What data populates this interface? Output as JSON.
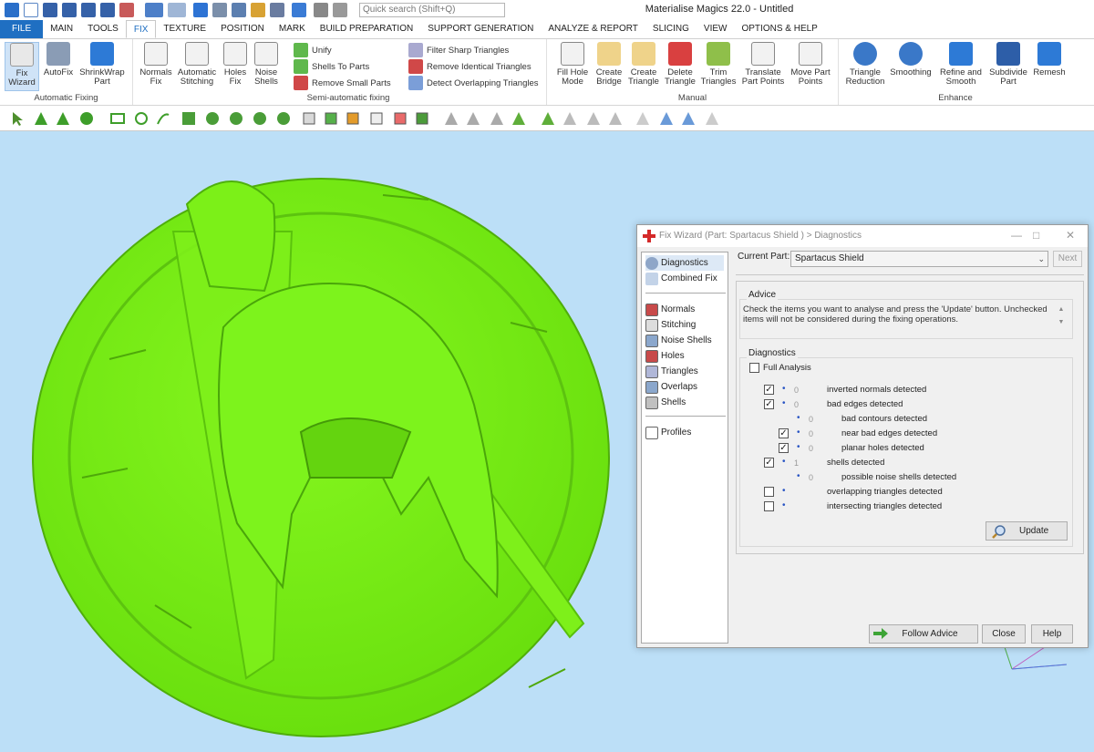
{
  "app": {
    "title": "Materialise Magics 22.0 - Untitled",
    "quick_search_placeholder": "Quick search (Shift+Q)"
  },
  "menu": {
    "tabs": [
      "FILE",
      "MAIN",
      "TOOLS",
      "FIX",
      "TEXTURE",
      "POSITION",
      "MARK",
      "BUILD PREPARATION",
      "SUPPORT GENERATION",
      "ANALYZE & REPORT",
      "SLICING",
      "VIEW",
      "OPTIONS & HELP"
    ],
    "active_tab": "FIX"
  },
  "ribbon": {
    "automatic_fixing": {
      "label": "Automatic Fixing",
      "fix_wizard": "Fix\nWizard",
      "autofix": "AutoFix",
      "shrinkwrap": "ShrinkWrap\nPart"
    },
    "semi_automatic": {
      "label": "Semi-automatic fixing",
      "normals_fix": "Normals\nFix",
      "automatic_stitching": "Automatic\nStitching",
      "holes_fix": "Holes\nFix",
      "noise_shells": "Noise\nShells",
      "unify": "Unify",
      "shells_to_parts": "Shells To Parts",
      "remove_small_parts": "Remove Small Parts",
      "filter_sharp_triangles": "Filter Sharp Triangles",
      "remove_identical_triangles": "Remove Identical Triangles",
      "detect_overlapping_triangles": "Detect Overlapping Triangles"
    },
    "manual": {
      "label": "Manual",
      "fill_hole_mode": "Fill Hole\nMode",
      "create_bridge": "Create\nBridge",
      "create_triangle": "Create\nTriangle",
      "delete_triangle": "Delete\nTriangle",
      "trim_triangles": "Trim\nTriangles",
      "translate_part_points": "Translate\nPart Points",
      "move_part_points": "Move Part\nPoints"
    },
    "enhance": {
      "label": "Enhance",
      "triangle_reduction": "Triangle\nReduction",
      "smoothing": "Smoothing",
      "refine_and_smooth": "Refine and\nSmooth",
      "subdivide_part": "Subdivide\nPart",
      "remesh": "Remesh"
    }
  },
  "dialog": {
    "title": "Fix Wizard (Part: Spartacus Shield ) > Diagnostics",
    "current_part_label": "Current Part:",
    "current_part_value": "Spartacus Shield",
    "next_label": "Next",
    "nav": {
      "diagnostics": "Diagnostics",
      "combined_fix": "Combined Fix",
      "normals": "Normals",
      "stitching": "Stitching",
      "noise_shells": "Noise Shells",
      "holes": "Holes",
      "triangles": "Triangles",
      "overlaps": "Overlaps",
      "shells": "Shells",
      "profiles": "Profiles"
    },
    "advice_label": "Advice",
    "advice_text": "Check the items you want to analyse and press the 'Update' button. Unchecked items will not be considered during the fixing operations.",
    "diagnostics_label": "Diagnostics",
    "full_analysis": "Full Analysis",
    "items": [
      {
        "label": "inverted normals detected",
        "value": "0",
        "checked": true
      },
      {
        "label": "bad edges detected",
        "value": "0",
        "checked": true
      },
      {
        "label": "bad contours detected",
        "value": "0",
        "checked": null
      },
      {
        "label": "near bad edges detected",
        "value": "0",
        "checked": true
      },
      {
        "label": "planar holes detected",
        "value": "0",
        "checked": true
      },
      {
        "label": "shells detected",
        "value": "1",
        "checked": true
      },
      {
        "label": "possible noise shells detected",
        "value": "0",
        "checked": null
      },
      {
        "label": "overlapping triangles detected",
        "value": "",
        "checked": false
      },
      {
        "label": "intersecting triangles detected",
        "value": "",
        "checked": false
      }
    ],
    "update_label": "Update",
    "follow_advice_label": "Follow Advice",
    "close_label": "Close",
    "help_label": "Help"
  },
  "colors": {
    "viewport_bg": "#bcdff7",
    "model_green": "#7cf218",
    "accent_blue": "#1f6fc2"
  }
}
